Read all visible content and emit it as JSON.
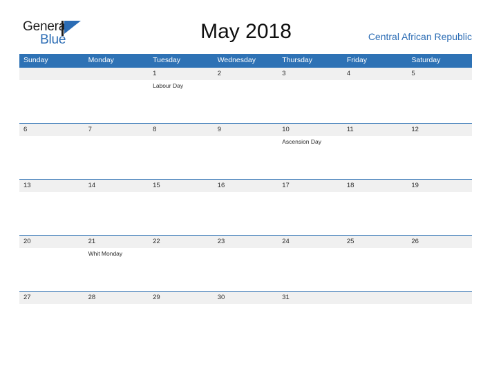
{
  "logo": {
    "text_primary": "General",
    "text_secondary": "Blue",
    "mark": "triangle-flag-icon",
    "color_primary": "#1c1c1c",
    "color_secondary": "#2b6cb4"
  },
  "header": {
    "title": "May 2018",
    "region": "Central African Republic",
    "accent_color": "#2e72b5"
  },
  "calendar": {
    "day_headers": [
      "Sunday",
      "Monday",
      "Tuesday",
      "Wednesday",
      "Thursday",
      "Friday",
      "Saturday"
    ],
    "header_bg": "#2e72b5",
    "header_text_color": "#ffffff",
    "band_bg": "#f0f0f0",
    "border_color": "#2e72b5",
    "weeks": [
      [
        {
          "date": "",
          "events": []
        },
        {
          "date": "",
          "events": []
        },
        {
          "date": "1",
          "events": [
            "Labour Day"
          ]
        },
        {
          "date": "2",
          "events": []
        },
        {
          "date": "3",
          "events": []
        },
        {
          "date": "4",
          "events": []
        },
        {
          "date": "5",
          "events": []
        }
      ],
      [
        {
          "date": "6",
          "events": []
        },
        {
          "date": "7",
          "events": []
        },
        {
          "date": "8",
          "events": []
        },
        {
          "date": "9",
          "events": []
        },
        {
          "date": "10",
          "events": [
            "Ascension Day"
          ]
        },
        {
          "date": "11",
          "events": []
        },
        {
          "date": "12",
          "events": []
        }
      ],
      [
        {
          "date": "13",
          "events": []
        },
        {
          "date": "14",
          "events": []
        },
        {
          "date": "15",
          "events": []
        },
        {
          "date": "16",
          "events": []
        },
        {
          "date": "17",
          "events": []
        },
        {
          "date": "18",
          "events": []
        },
        {
          "date": "19",
          "events": []
        }
      ],
      [
        {
          "date": "20",
          "events": []
        },
        {
          "date": "21",
          "events": [
            "Whit Monday"
          ]
        },
        {
          "date": "22",
          "events": []
        },
        {
          "date": "23",
          "events": []
        },
        {
          "date": "24",
          "events": []
        },
        {
          "date": "25",
          "events": []
        },
        {
          "date": "26",
          "events": []
        }
      ],
      [
        {
          "date": "27",
          "events": []
        },
        {
          "date": "28",
          "events": []
        },
        {
          "date": "29",
          "events": []
        },
        {
          "date": "30",
          "events": []
        },
        {
          "date": "31",
          "events": []
        },
        {
          "date": "",
          "events": []
        },
        {
          "date": "",
          "events": []
        }
      ]
    ]
  }
}
